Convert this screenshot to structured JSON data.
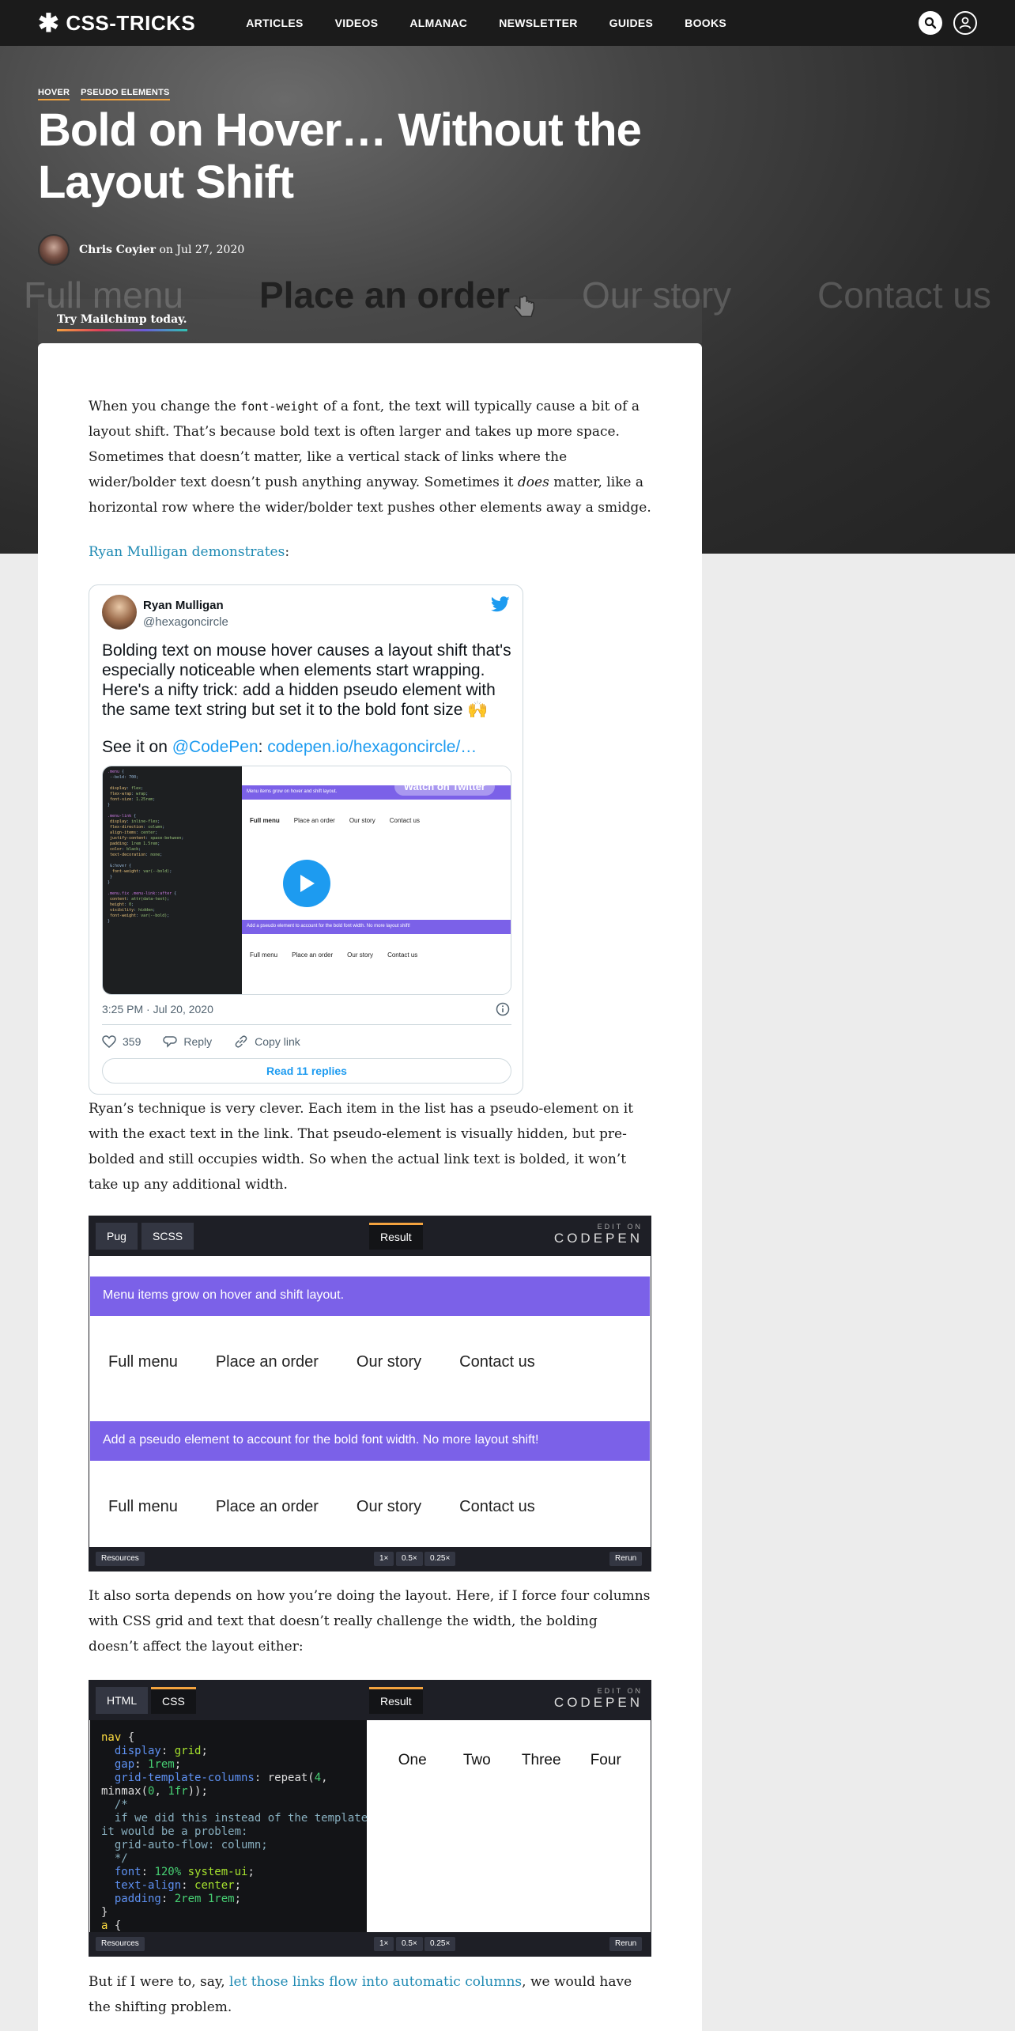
{
  "nav": {
    "logo": "CSS-TRICKS",
    "links": [
      "ARTICLES",
      "VIDEOS",
      "ALMANAC",
      "NEWSLETTER",
      "GUIDES",
      "BOOKS"
    ]
  },
  "hero": {
    "tags": [
      "HOVER",
      "PSEUDO ELEMENTS"
    ],
    "title": "Bold on Hover… Without the Layout Shift",
    "author": "Chris Coyier",
    "date_prefix": "on",
    "date": "Jul 27, 2020",
    "ghost_nav": [
      "Full menu",
      "Place an order",
      "Our story",
      "Contact us"
    ],
    "ad_text": "Try Mailchimp today."
  },
  "article": {
    "p1_a": "When you change the ",
    "p1_code": "font-weight",
    "p1_b": " of a font, the text will typically cause a bit of a layout shift. That’s because bold text is often larger and takes up more space. Sometimes that doesn’t matter, like a vertical stack of links where the wider/bolder text doesn’t push anything anyway. Sometimes it ",
    "p1_em": "does",
    "p1_c": " matter, like a horizontal row where the wider/bolder text pushes other elements away a smidge.",
    "p2_link": "Ryan Mulligan demonstrates",
    "p2_tail": ":",
    "p3": "Ryan’s technique is very clever. Each item in the list has a pseudo-element on it with the exact text in the link. That pseudo-element is visually hidden, but pre-bolded and still occupies width. So when the actual link text is bolded, it won’t take up any additional width.",
    "p4": "It also sorta depends on how you’re doing the layout. Here, if I force four columns with CSS grid and text that doesn’t really challenge the width, the bolding doesn’t affect the layout either:",
    "p5_a": "But if I were to, say, ",
    "p5_link": "let those links flow into automatic columns",
    "p5_b": ", we would have the shifting problem."
  },
  "tweet": {
    "name": "Ryan Mulligan",
    "handle": "@hexagoncircle",
    "text": "Bolding text on mouse hover causes a layout shift that's especially noticeable when elements start wrapping. Here's a nifty trick: add a hidden pseudo element with the same text string but set it to the bold font size 🙌",
    "see_prefix": "See it on ",
    "see_codepen": "@CodePen",
    "see_colon": ": ",
    "see_link": "codepen.io/hexagoncircle/…",
    "watch": "Watch on Twitter",
    "media_bar1": "Menu items grow on hover and shift layout.",
    "media_bar2": "Add a pseudo element to account for the bold font width. No more layout shift!",
    "media_items": [
      "Full menu",
      "Place an order",
      "Our story",
      "Contact us"
    ],
    "time": "3:25 PM · Jul 20, 2020",
    "likes": "359",
    "reply": "Reply",
    "copy": "Copy link",
    "read_replies": "Read 11 replies"
  },
  "pen1": {
    "tabs": [
      "Pug",
      "SCSS"
    ],
    "result": "Result",
    "edit_small": "EDIT ON",
    "edit_big": "CODEPEN",
    "bar1": "Menu items grow on hover and shift layout.",
    "bar2": "Add a pseudo element to account for the bold font width. No more layout shift!",
    "items": [
      "Full menu",
      "Place an order",
      "Our story",
      "Contact us"
    ],
    "resources": "Resources",
    "zoom": [
      "1×",
      "0.5×",
      "0.25×"
    ],
    "rerun": "Rerun"
  },
  "pen2": {
    "tabs": [
      "HTML",
      "CSS"
    ],
    "result": "Result",
    "edit_small": "EDIT ON",
    "edit_big": "CODEPEN",
    "cols": [
      "One",
      "Two",
      "Three",
      "Four"
    ],
    "resources": "Resources",
    "zoom": [
      "1×",
      "0.5×",
      "0.25×"
    ],
    "rerun": "Rerun"
  },
  "colors": {
    "accent_orange": "#f3a33f",
    "link_blue": "#1f8ab3",
    "twitter_blue": "#1d9bf0",
    "codepen_purple": "#7b61e8"
  }
}
